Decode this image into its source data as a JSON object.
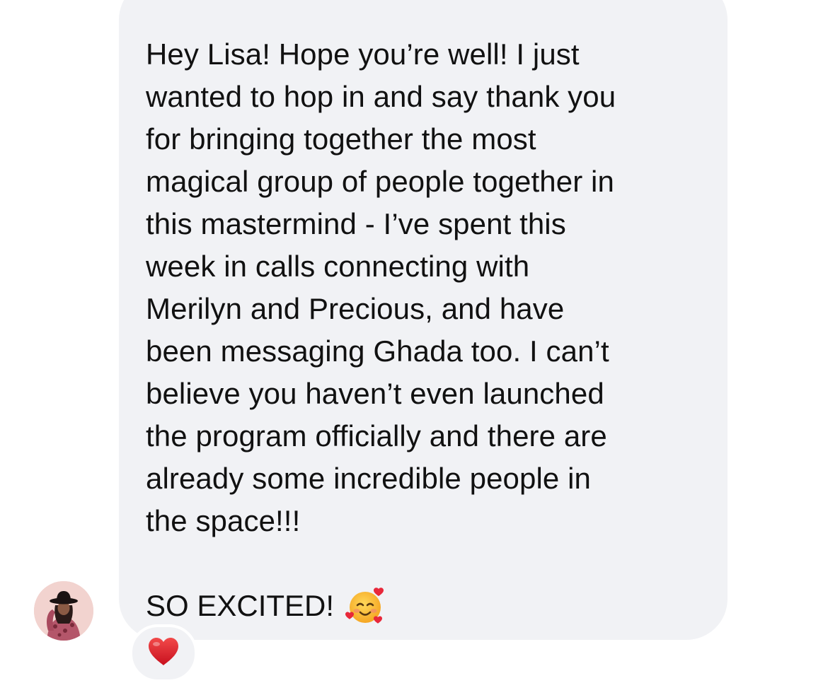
{
  "conversation": {
    "message": {
      "lines": [
        "Hey Lisa! Hope you’re well! I just",
        "wanted to hop in and say thank you",
        "for bringing together the most",
        "magical group of people together in",
        "this mastermind - I’ve spent this",
        "week in calls connecting with",
        "Merilyn and Precious, and have",
        "been messaging Ghada too. I can’t",
        "believe you haven’t even launched",
        "the program officially and there are",
        "already some incredible people in",
        "the space!!!"
      ],
      "closing_line": "SO EXCITED!",
      "closing_emoji": "smiling-face-with-hearts-icon"
    },
    "reaction": {
      "icon": "red-heart-icon",
      "color": "#e0202c"
    },
    "colors": {
      "bubble": "#f1f2f5",
      "text": "#111111"
    }
  }
}
